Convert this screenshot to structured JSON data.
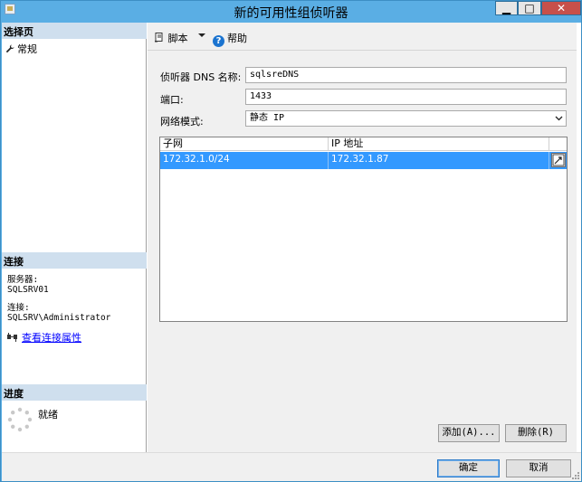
{
  "window": {
    "title": "新的可用性组侦听器",
    "min_glyph": "▁",
    "max_glyph": "□",
    "close_glyph": "✕"
  },
  "left": {
    "select_page_header": "选择页",
    "pages": [
      {
        "label": "常规",
        "icon": "wrench-icon"
      }
    ],
    "connection_header": "连接",
    "server_label": "服务器:",
    "server_value": "SQLSRV01",
    "connection_label": "连接:",
    "connection_value": "SQLSRV\\Administrator",
    "view_props_link": "查看连接属性",
    "progress_header": "进度",
    "status": "就绪"
  },
  "toolbar": {
    "script_label": "脚本",
    "help_label": "帮助"
  },
  "form": {
    "dns_label": "侦听器 DNS 名称:",
    "dns_value": "sqlsreDNS",
    "port_label": "端口:",
    "port_value": "1433",
    "mode_label": "网络模式:",
    "mode_value": "静态 IP"
  },
  "grid": {
    "columns": [
      "子网",
      "IP 地址"
    ],
    "rows": [
      {
        "subnet": "172.32.1.0/24",
        "ip": "172.32.1.87"
      }
    ]
  },
  "buttons": {
    "add": "添加(A)...",
    "remove": "删除(R)",
    "ok": "确定",
    "cancel": "取消"
  },
  "colors": {
    "title_bar": "#5aaee4",
    "close_button": "#c7504a",
    "selection": "#3399ff",
    "section_header": "#cfdfee",
    "link": "#0000ff"
  }
}
